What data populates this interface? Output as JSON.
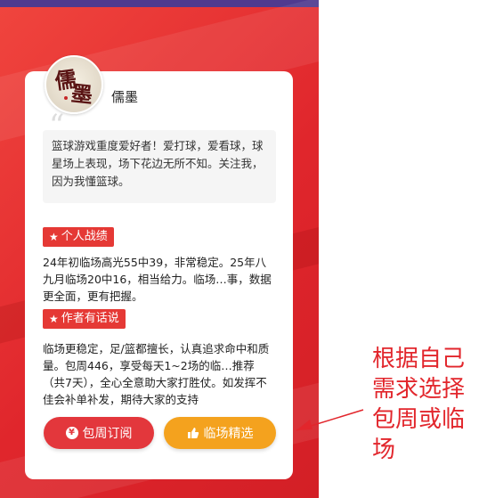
{
  "author": {
    "name": "儒墨",
    "avatar_text": "儒墨"
  },
  "intro": "篮球游戏重度爱好者！爱打球，爱看球，球星场上表现，场下花边无所不知。关注我，因为我懂篮球。",
  "sections": [
    {
      "tag": "个人战绩",
      "text": "24年初临场高光55中39，非常稳定。25年八九月临场20中16，相当给力。临场…事，数据更全面，更有把握。"
    },
    {
      "tag": "作者有话说",
      "text": "临场更稳定，足/篮都擅长，认真追求命中和质量。包周446，享受每天1~2场的临…推荐（共7天），全心全意助大家打胜仗。如发挥不佳会补单补发，期待大家的支持"
    }
  ],
  "buttons": {
    "subscribe": "包周订阅",
    "select": "临场精选"
  },
  "annotation": "根据自己需求选择包周或临场",
  "colors": {
    "background_red": "#e0262c",
    "tag_red": "#e53935",
    "subscribe_red": "#e3373c",
    "select_orange": "#f4a21e",
    "annotation_red": "#e2262c"
  }
}
